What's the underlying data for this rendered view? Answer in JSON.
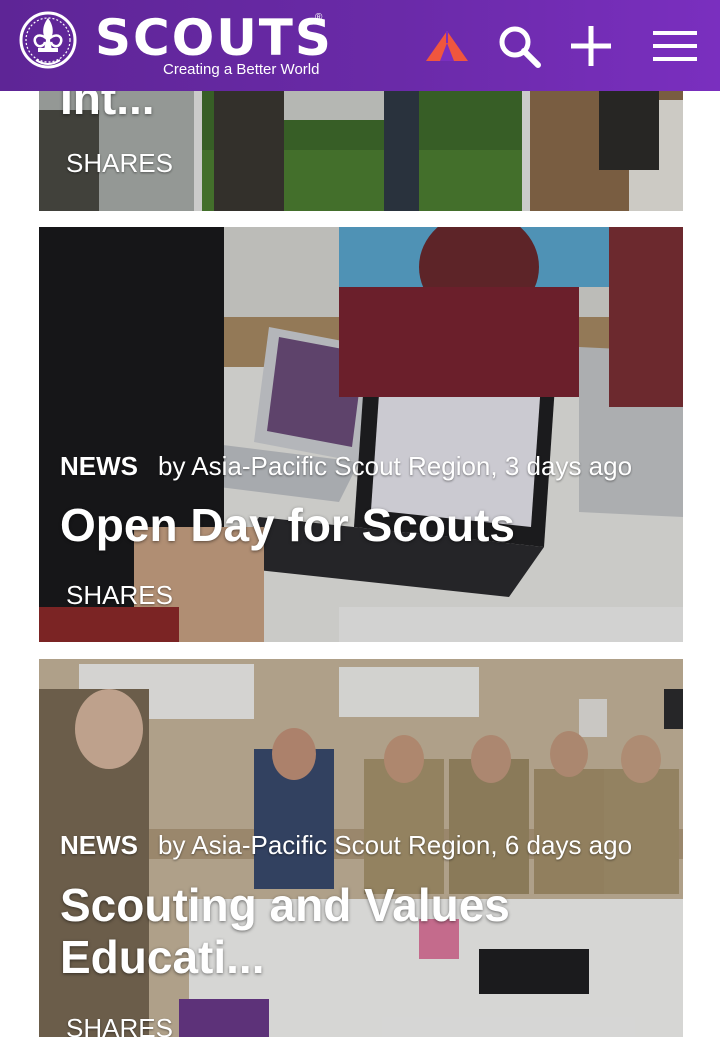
{
  "header": {
    "brand_name": "SCOUTS",
    "registered_mark": "®",
    "tagline": "Creating a Better World",
    "icons": [
      "scouts-emblem-icon",
      "tent-icon",
      "search-icon",
      "plus-icon",
      "hamburger-menu-icon"
    ]
  },
  "articles": [
    {
      "title": "Int...",
      "shares_label": "SHARES"
    },
    {
      "category": "NEWS",
      "byline": "by Asia-Pacific Scout Region, 3 days ago",
      "title": "Open Day for Scouts",
      "shares_label": "SHARES"
    },
    {
      "category": "NEWS",
      "byline": "by Asia-Pacific Scout Region, 6 days ago",
      "title": "Scouting and Values Educati...",
      "shares_label": "SHARES"
    }
  ],
  "colors": {
    "header_purple": "#6a2aa8",
    "tent_accent": "#f0563e",
    "text_white": "#ffffff"
  }
}
